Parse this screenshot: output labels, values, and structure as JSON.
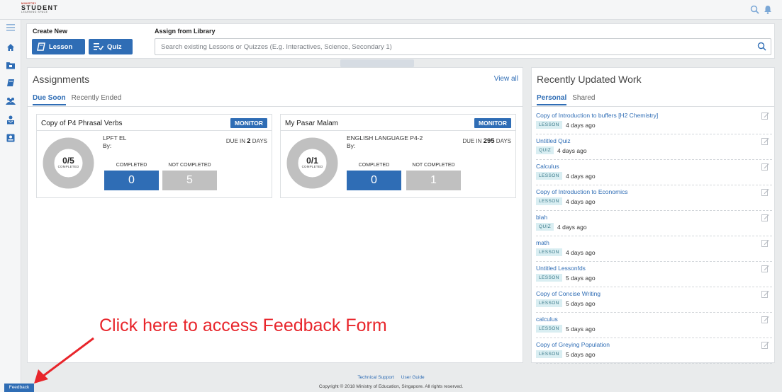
{
  "brand": {
    "top": "MINISTRY",
    "main": "STUDENT",
    "sub": "LEARNING SPACE"
  },
  "topbar": {
    "icons": [
      "search-icon",
      "bell-icon"
    ]
  },
  "sidebar": {
    "icons": [
      "menu-icon",
      "home-icon",
      "folder-icon",
      "book-icon",
      "group-icon",
      "student-icon",
      "contact-icon"
    ]
  },
  "create": {
    "create_new_label": "Create New",
    "assign_label": "Assign from Library",
    "lesson_button": "Lesson",
    "quiz_button": "Quiz",
    "search_placeholder": "Search existing Lessons or Quizzes (E.g. Interactives, Science, Secondary 1)"
  },
  "assignments": {
    "title": "Assignments",
    "view_all": "View all",
    "tabs": [
      "Due Soon",
      "Recently Ended"
    ],
    "cards": [
      {
        "title": "Copy of P4 Phrasal Verbs",
        "monitor": "MONITOR",
        "class": "LPFT EL",
        "by": "By:",
        "due_prefix": "DUE IN",
        "due_value": "2",
        "due_unit": "DAYS",
        "progress": "0/5",
        "progress_label": "COMPLETED",
        "completed_label": "COMPLETED",
        "not_completed_label": "NOT COMPLETED",
        "completed": "0",
        "not_completed": "5"
      },
      {
        "title": "My Pasar Malam",
        "monitor": "MONITOR",
        "class": "ENGLISH LANGUAGE P4-2",
        "by": "By:",
        "due_prefix": "DUE IN",
        "due_value": "295",
        "due_unit": "DAYS",
        "progress": "0/1",
        "progress_label": "COMPLETED",
        "completed_label": "COMPLETED",
        "not_completed_label": "NOT COMPLETED",
        "completed": "0",
        "not_completed": "1"
      }
    ]
  },
  "recent": {
    "title": "Recently Updated Work",
    "tabs": [
      "Personal",
      "Shared"
    ],
    "items": [
      {
        "title": "Copy of Introduction to buffers [H2 Chemistry]",
        "type": "LESSON",
        "age": "4 days ago"
      },
      {
        "title": "Untitled Quiz",
        "type": "QUIZ",
        "age": "4 days ago"
      },
      {
        "title": "Calculus",
        "type": "LESSON",
        "age": "4 days ago"
      },
      {
        "title": "Copy of Introduction to Economics",
        "type": "LESSON",
        "age": "4 days ago"
      },
      {
        "title": "blah",
        "type": "QUIZ",
        "age": "4 days ago"
      },
      {
        "title": "math",
        "type": "LESSON",
        "age": "4 days ago"
      },
      {
        "title": "Untitled Lessonfds",
        "type": "LESSON",
        "age": "5 days ago"
      },
      {
        "title": "Copy of Concise Writing",
        "type": "LESSON",
        "age": "5 days ago"
      },
      {
        "title": "calculus",
        "type": "LESSON",
        "age": "5 days ago"
      },
      {
        "title": "Copy of Greying Population",
        "type": "LESSON",
        "age": "5 days ago"
      }
    ]
  },
  "footer": {
    "technical_support": "Technical Support",
    "user_guide": "User Guide",
    "copyright": "Copyright © 2018 Ministry of Education, Singapore. All rights reserved.",
    "feedback": "Feedback"
  },
  "annotation": {
    "text": "Click here to access Feedback Form",
    "color": "#e8252b"
  },
  "colors": {
    "accent": "#2f6db5",
    "grey": "#c0c0c0",
    "tag_bg": "#d9eef2"
  }
}
